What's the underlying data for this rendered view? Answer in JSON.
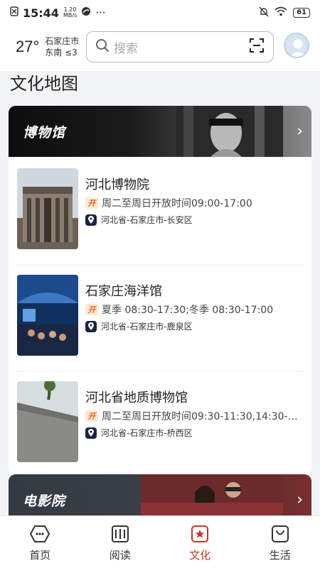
{
  "status_bar": {
    "time": "15:44",
    "net_speed_value": "1.20",
    "net_speed_unit": "MB/s",
    "more": "···",
    "battery": "61"
  },
  "header": {
    "temperature": "27°",
    "city": "石家庄市",
    "wind": "东南 ≤3",
    "search_placeholder": "搜索"
  },
  "page_title": "文化地图",
  "sections": [
    {
      "title": "博物馆",
      "venues": [
        {
          "name": "河北博物院",
          "hours": "周二至周日开放时间09:00-17:00",
          "address": "河北省-石家庄市-长安区"
        },
        {
          "name": "石家庄海洋馆",
          "hours": "夏季 08:30-17:30;冬季 08:30-17:00",
          "address": "河北省-石家庄市-鹿泉区"
        },
        {
          "name": "河北省地质博物馆",
          "hours": "周二至周日开放时间09:30-11:30,14:30-…",
          "address": "河北省-石家庄市-桥西区"
        }
      ]
    },
    {
      "title": "电影院",
      "venues": []
    }
  ],
  "bottom_nav": [
    {
      "label": "首页",
      "icon": "home-icon",
      "active": false
    },
    {
      "label": "阅读",
      "icon": "book-icon",
      "active": false
    },
    {
      "label": "文化",
      "icon": "culture-star-icon",
      "active": true
    },
    {
      "label": "生活",
      "icon": "bag-icon",
      "active": false
    }
  ],
  "colors": {
    "accent": "#c0392b",
    "open_badge": "#e5651c",
    "pin_badge": "#1d2340"
  },
  "icons": {
    "open_badge_text": "开"
  }
}
